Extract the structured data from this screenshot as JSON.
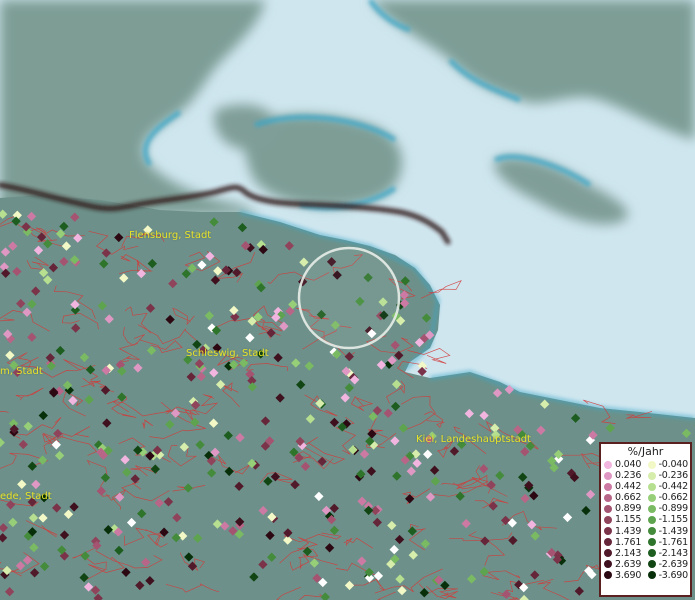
{
  "map": {
    "place_labels": [
      {
        "id": "flensburg",
        "text": "Flensburg, Stadt"
      },
      {
        "id": "schleswig",
        "text": "Schleswig, Stadt"
      },
      {
        "id": "kiel",
        "text": "Kiel, Landeshauptstadt"
      },
      {
        "id": "husum",
        "text": "m, Stadt"
      },
      {
        "id": "rendsburg",
        "text": "ede, Stadt"
      }
    ],
    "colors": {
      "sea": "#cfe6ef",
      "land_far": "#7a9a91",
      "land_near": "#6c918a",
      "border_line": "#2e1818",
      "district_lines": "#d33a3a",
      "coast_shallow": "#3aa6c7"
    }
  },
  "legend": {
    "title": "%/Jahr",
    "positive": [
      {
        "value": "0.040",
        "color": "#f1b5e0"
      },
      {
        "value": "0.236",
        "color": "#df98c3"
      },
      {
        "value": "0.442",
        "color": "#cc7aa4"
      },
      {
        "value": "0.662",
        "color": "#b86688"
      },
      {
        "value": "0.899",
        "color": "#a45470"
      },
      {
        "value": "1.155",
        "color": "#90445c"
      },
      {
        "value": "1.439",
        "color": "#7a3349"
      },
      {
        "value": "1.761",
        "color": "#66263a"
      },
      {
        "value": "2.143",
        "color": "#511a2b"
      },
      {
        "value": "2.639",
        "color": "#3f111f"
      },
      {
        "value": "3.690",
        "color": "#2c0813"
      }
    ],
    "negative": [
      {
        "value": "-0.040",
        "color": "#f3f8c7"
      },
      {
        "value": "-0.236",
        "color": "#d6edab"
      },
      {
        "value": "-0.442",
        "color": "#b6df90"
      },
      {
        "value": "-0.662",
        "color": "#97cf78"
      },
      {
        "value": "-0.899",
        "color": "#7aba62"
      },
      {
        "value": "-1.155",
        "color": "#5ea44e"
      },
      {
        "value": "-1.439",
        "color": "#448c3b"
      },
      {
        "value": "-1.761",
        "color": "#2e742b"
      },
      {
        "value": "-2.143",
        "color": "#1d5d1f"
      },
      {
        "value": "-2.639",
        "color": "#114614"
      },
      {
        "value": "-3.690",
        "color": "#07300a"
      }
    ]
  }
}
